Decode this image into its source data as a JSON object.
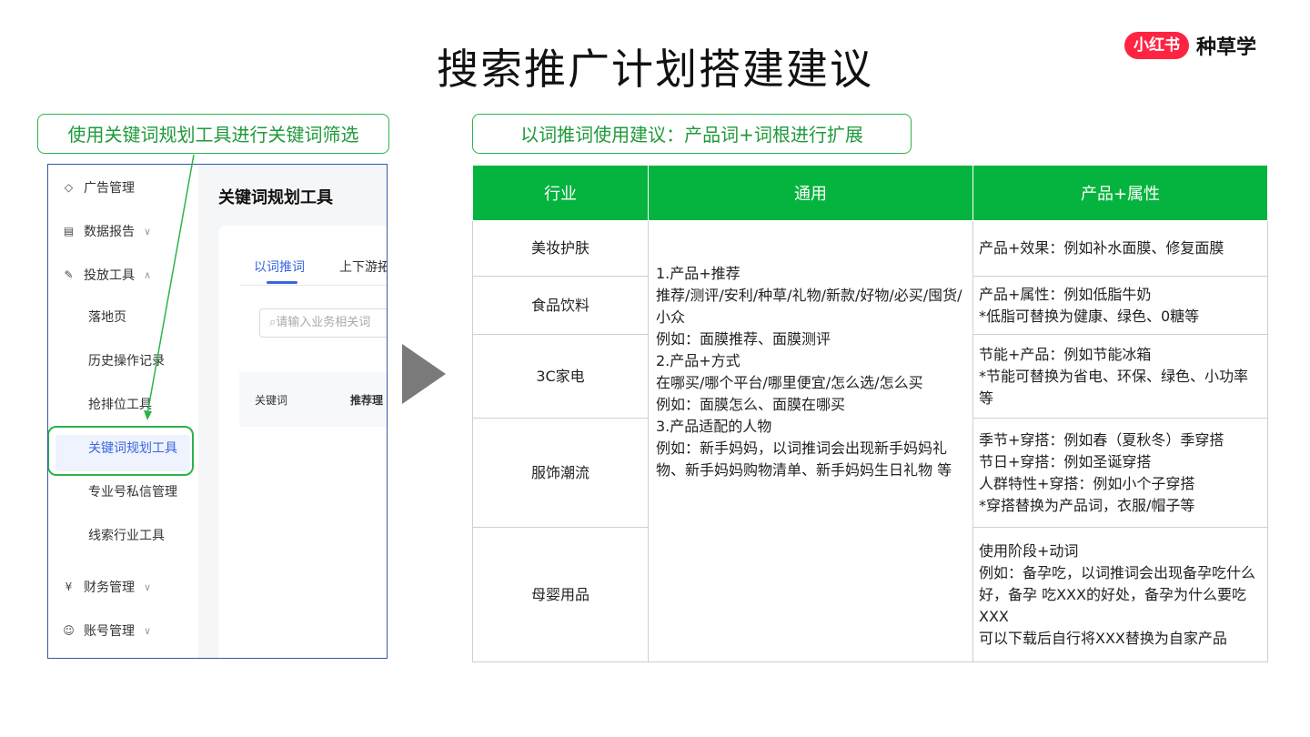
{
  "title": "搜索推广计划搭建建议",
  "logo": {
    "badge": "小红书",
    "text": "种草学"
  },
  "left_tag": "使用关键词规划工具进行关键词筛选",
  "right_tag": "以词推词使用建议：产品词+词根进行扩展",
  "screenshot": {
    "sidebar": {
      "items": [
        {
          "label": "广告管理",
          "icon": "tag-icon"
        },
        {
          "label": "数据报告",
          "icon": "report-icon",
          "chevron": "∨"
        },
        {
          "label": "投放工具",
          "icon": "tool-icon",
          "chevron": "∧"
        }
      ],
      "sub_items": [
        "落地页",
        "历史操作记录",
        "抢排位工具",
        "关键词规划工具",
        "专业号私信管理",
        "线索行业工具"
      ],
      "bottom_items": [
        {
          "label": "财务管理",
          "icon": "yen-icon",
          "chevron": "∨"
        },
        {
          "label": "账号管理",
          "icon": "account-icon",
          "chevron": "∨"
        }
      ]
    },
    "tool_title": "关键词规划工具",
    "tabs": [
      "以词推词",
      "上下游拓"
    ],
    "search_placeholder": "请输入业务相关词",
    "columns": [
      "关键词",
      "推荐理"
    ]
  },
  "table": {
    "headers": [
      "行业",
      "通用",
      "产品+属性"
    ],
    "industries": [
      "美妆护肤",
      "食品饮料",
      "3C家电",
      "服饰潮流",
      "母婴用品"
    ],
    "general": [
      "1.产品+推荐",
      "推荐/测评/安利/种草/礼物/新款/好物/必买/囤货/小众",
      "例如：面膜推荐、面膜测评",
      "2.产品+方式",
      "在哪买/哪个平台/哪里便宜/怎么选/怎么买",
      "例如：面膜怎么、面膜在哪买",
      "3.产品适配的人物",
      "例如：新手妈妈，以词推词会出现新手妈妈礼物、新手妈妈购物清单、新手妈妈生日礼物 等"
    ],
    "attributes": [
      [
        "产品+效果：例如补水面膜、修复面膜"
      ],
      [
        "产品+属性：例如低脂牛奶",
        "*低脂可替换为健康、绿色、0糖等"
      ],
      [
        "节能+产品：例如节能冰箱",
        "*节能可替换为省电、环保、绿色、小功率等"
      ],
      [
        "季节+穿搭：例如春（夏秋冬）季穿搭",
        "节日+穿搭：例如圣诞穿搭",
        "人群特性+穿搭：例如小个子穿搭",
        "*穿搭替换为产品词，衣服/帽子等"
      ],
      [
        "使用阶段+动词",
        "例如：备孕吃，以词推词会出现备孕吃什么好，备孕 吃XXX的好处，备孕为什么要吃XXX",
        "可以下载后自行将XXX替换为自家产品"
      ]
    ]
  },
  "colors": {
    "accent_green": "#05b43e",
    "tag_green": "#2db34a",
    "link_blue": "#3b64e0",
    "brand_red": "#ff2442"
  }
}
